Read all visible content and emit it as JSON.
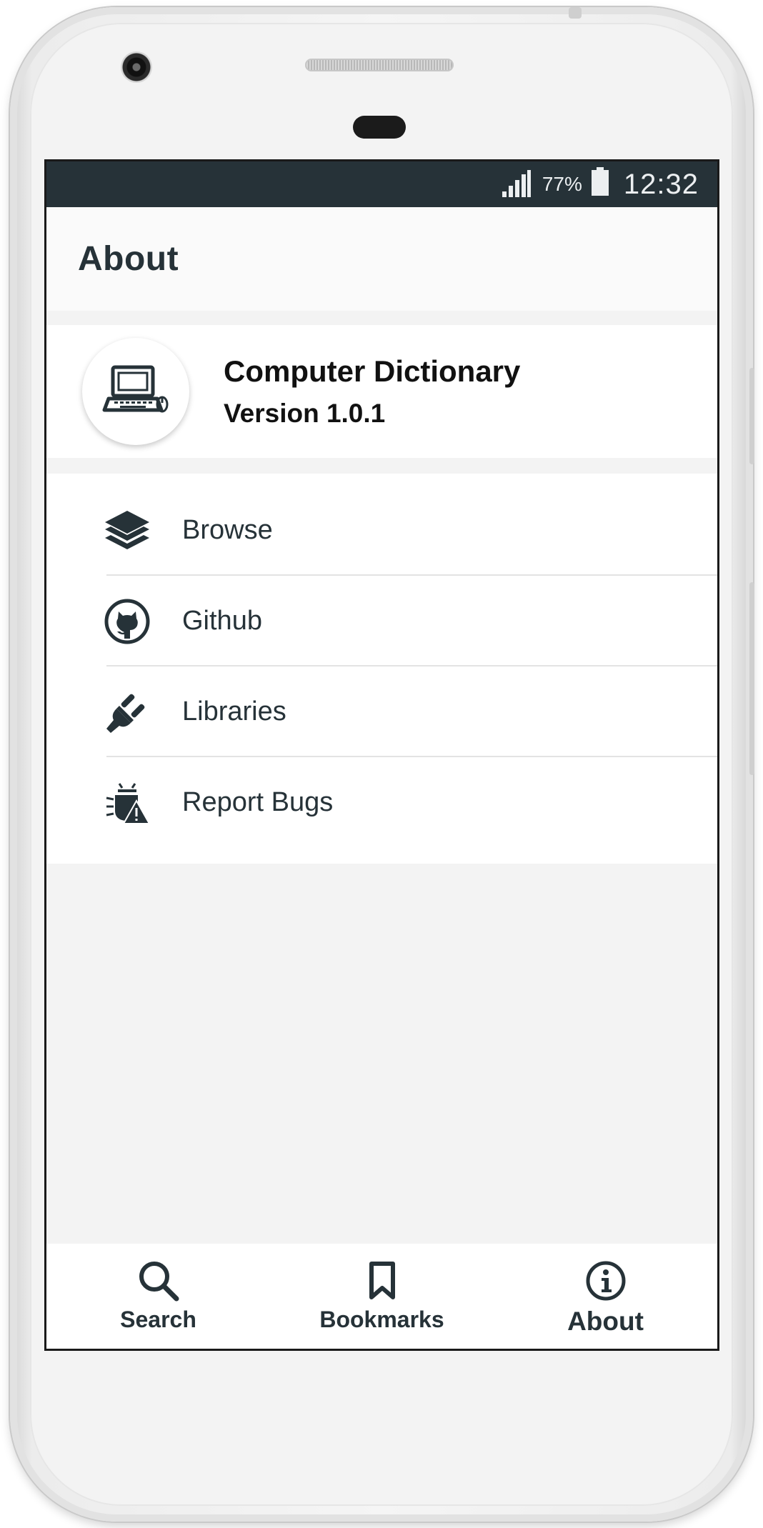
{
  "status_bar": {
    "battery_percent": "77%",
    "time": "12:32",
    "signal_icon": "signal-icon",
    "battery_icon": "battery-icon"
  },
  "app_bar": {
    "title": "About"
  },
  "app_info": {
    "name": "Computer Dictionary",
    "version": "Version 1.0.1",
    "logo_icon": "laptop-icon"
  },
  "menu": {
    "items": [
      {
        "label": "Browse",
        "icon": "layers-icon"
      },
      {
        "label": "Github",
        "icon": "github-icon"
      },
      {
        "label": "Libraries",
        "icon": "plug-icon"
      },
      {
        "label": "Report Bugs",
        "icon": "bug-report-icon"
      }
    ]
  },
  "bottom_nav": {
    "items": [
      {
        "label": "Search",
        "icon": "search-icon",
        "active": false
      },
      {
        "label": "Bookmarks",
        "icon": "bookmark-icon",
        "active": false
      },
      {
        "label": "About",
        "icon": "info-icon",
        "active": true
      }
    ]
  },
  "colors": {
    "status_bar": "#263238",
    "text_primary": "#263238",
    "screen_background": "#f3f3f3",
    "surface": "#ffffff"
  }
}
